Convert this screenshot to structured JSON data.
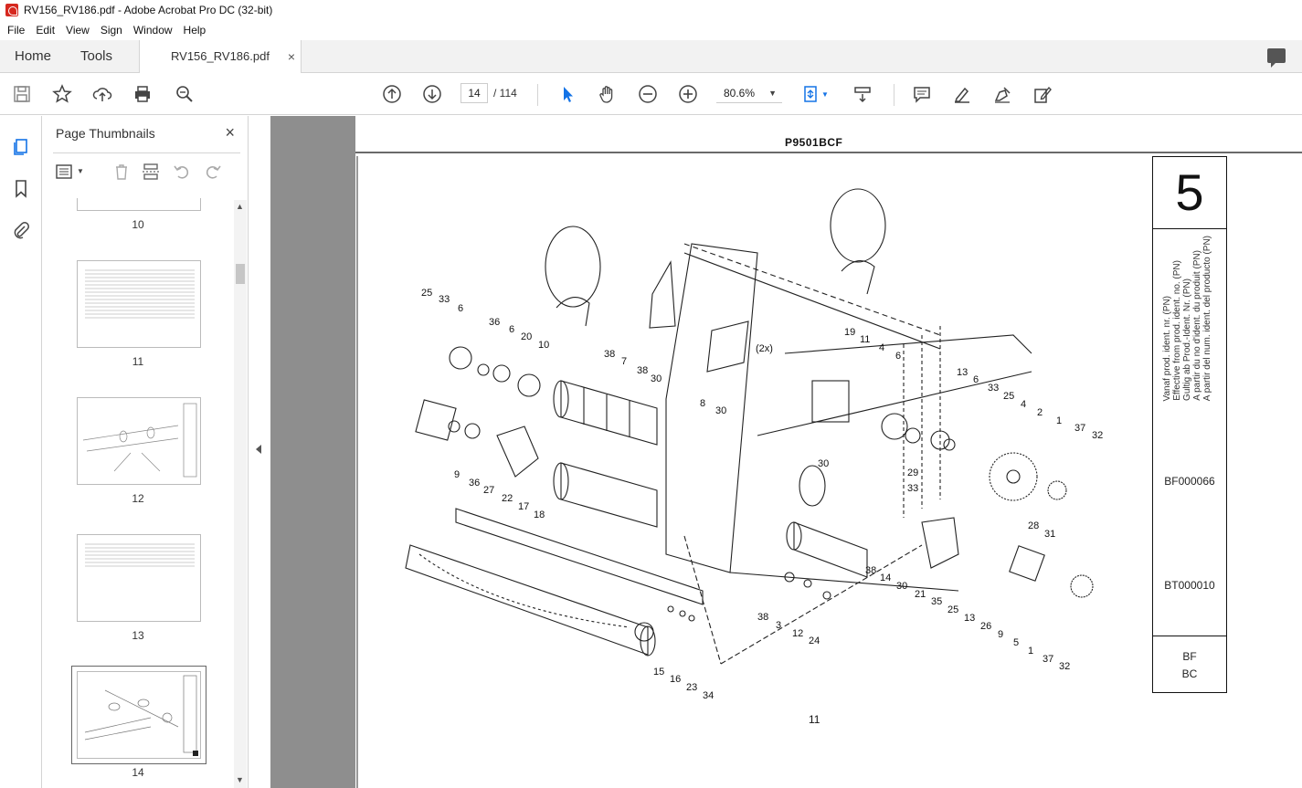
{
  "window": {
    "title": "RV156_RV186.pdf - Adobe Acrobat Pro DC (32-bit)"
  },
  "menu": [
    "File",
    "Edit",
    "View",
    "Sign",
    "Window",
    "Help"
  ],
  "tabs": {
    "home": "Home",
    "tools": "Tools",
    "document": "RV156_RV186.pdf",
    "close": "×"
  },
  "toolbar": {
    "current_page": "14",
    "total_pages": "/ 114",
    "zoom": "80.6%"
  },
  "panel": {
    "title": "Page Thumbnails",
    "close": "×",
    "thumbnails": [
      {
        "label": "10"
      },
      {
        "label": "11"
      },
      {
        "label": "12"
      },
      {
        "label": "13"
      },
      {
        "label": "14"
      }
    ]
  },
  "document": {
    "header_code": "P9501BCF",
    "page_number": "11",
    "side": {
      "section": "5",
      "lines": [
        "Vanaf prod. ident. nr. (PN)",
        "Effective from prod. ident. no. (PN)",
        "Gultig ab Prod.-Ident. Nr. (PN)",
        "A partir du no d'ident. du produit (PN)",
        "A partir del num. ident. del producto (PN)"
      ],
      "code1": "BF000066",
      "code2": "BT000010",
      "variant1": "BF",
      "variant2": "BC"
    },
    "callouts": [
      "25",
      "33",
      "6",
      "36",
      "6",
      "20",
      "10",
      "38",
      "7",
      "38",
      "30",
      "8",
      "30",
      "(2x)",
      "19",
      "11",
      "4",
      "6",
      "13",
      "6",
      "33",
      "25",
      "4",
      "2",
      "1",
      "37",
      "32",
      "9",
      "36",
      "27",
      "22",
      "17",
      "18",
      "29",
      "30",
      "33",
      "21",
      "14",
      "30",
      "38",
      "35",
      "25",
      "13",
      "26",
      "9",
      "28",
      "31",
      "5",
      "1",
      "37",
      "32",
      "38",
      "3",
      "12",
      "24",
      "15",
      "16",
      "23",
      "34"
    ]
  },
  "colors": {
    "accent": "#1473e6",
    "pdf_red": "#d6281f"
  }
}
